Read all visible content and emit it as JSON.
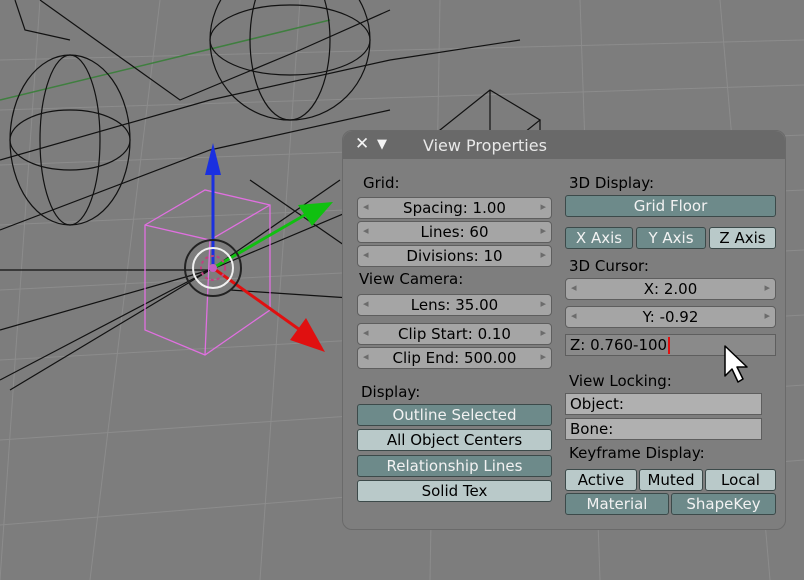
{
  "panel": {
    "title": "View Properties",
    "close_glyph": "✕",
    "collapse_glyph": "▼",
    "grid": {
      "label": "Grid:",
      "spacing": "Spacing: 1.00",
      "lines": "Lines: 60",
      "divisions": "Divisions: 10"
    },
    "view_camera": {
      "label": "View Camera:",
      "lens": "Lens: 35.00",
      "clip_start": "Clip Start: 0.10",
      "clip_end": "Clip End: 500.00"
    },
    "display": {
      "label": "Display:",
      "outline_selected": "Outline Selected",
      "all_object_centers": "All Object Centers",
      "relationship_lines": "Relationship Lines",
      "solid_tex": "Solid Tex"
    },
    "display_3d": {
      "label": "3D Display:",
      "grid_floor": "Grid Floor",
      "x_axis": "X Axis",
      "y_axis": "Y Axis",
      "z_axis": "Z Axis"
    },
    "cursor_3d": {
      "label": "3D Cursor:",
      "x": "X: 2.00",
      "y": "Y: -0.92",
      "z_editing": "Z: 0.760-100"
    },
    "view_locking": {
      "label": "View Locking:",
      "object": "Object:",
      "bone": "Bone:"
    },
    "keyframe_display": {
      "label": "Keyframe Display:",
      "active": "Active",
      "muted": "Muted",
      "local": "Local",
      "material": "Material",
      "shapekey": "ShapeKey"
    }
  },
  "arrow_glyphs": {
    "left": "◂",
    "right": "▸"
  },
  "icons": {
    "close": "close-icon",
    "collapse": "collapse-triangle-icon",
    "cursor": "mouse-pointer-icon"
  },
  "colors": {
    "panel_bg": "#7e7e7e",
    "header_bg": "#696969",
    "toggle_on": "#6d8a8a",
    "toggle_off": "#b9c9c9",
    "x_axis": "#e01010",
    "y_axis": "#10c010",
    "z_axis": "#1030e0",
    "selection": "#e070e0"
  }
}
